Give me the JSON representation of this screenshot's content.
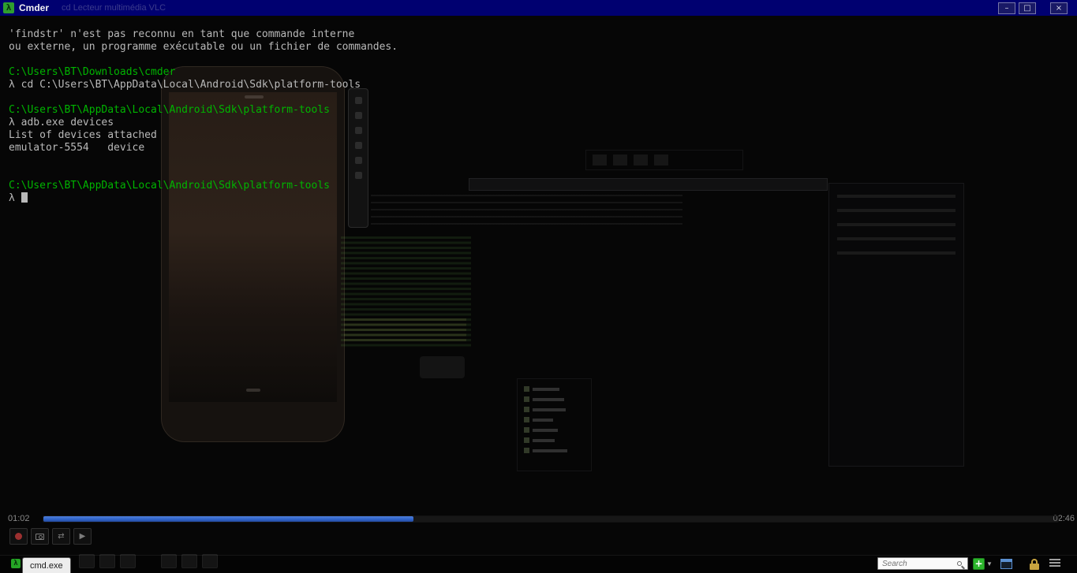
{
  "titlebar": {
    "title": "Cmder",
    "ghost_titles": "cd    Lecteur multimédia VLC"
  },
  "icons": {
    "lambda": "λ",
    "minimize": "–",
    "maximize": "□",
    "close": "×",
    "plus": "+",
    "dropdown": "▼",
    "loop_ab": "⇄",
    "frame_step": "▶"
  },
  "terminal": {
    "prompt_symbol": "λ",
    "lines": [
      {
        "text": "'findstr' n'est pas reconnu en tant que commande interne",
        "color": "gray"
      },
      {
        "text": "ou externe, un programme exécutable ou un fichier de commandes.",
        "color": "gray"
      },
      {
        "text": "",
        "color": "gray"
      },
      {
        "text": "C:\\Users\\BT\\Downloads\\cmder",
        "color": "green"
      },
      {
        "text": "λ cd C:\\Users\\BT\\AppData\\Local\\Android\\Sdk\\platform-tools",
        "color": "gray"
      },
      {
        "text": "",
        "color": "gray"
      },
      {
        "text": "C:\\Users\\BT\\AppData\\Local\\Android\\Sdk\\platform-tools",
        "color": "green"
      },
      {
        "text": "λ adb.exe devices",
        "color": "gray"
      },
      {
        "text": "List of devices attached",
        "color": "gray"
      },
      {
        "text": "emulator-5554   device",
        "color": "gray"
      },
      {
        "text": "",
        "color": "gray"
      },
      {
        "text": "",
        "color": "gray"
      },
      {
        "text": "C:\\Users\\BT\\AppData\\Local\\Android\\Sdk\\platform-tools",
        "color": "green"
      },
      {
        "text": "λ ",
        "color": "gray",
        "cursor": true
      }
    ]
  },
  "player": {
    "time_elapsed": "01:02",
    "time_remaining": "02:46",
    "progress_percent": 36.5
  },
  "statusbar": {
    "tab_label": "cmd.exe",
    "search_placeholder": "Search"
  },
  "colors": {
    "titlebar_blue": "#000070",
    "prompt_green": "#00b400",
    "terminal_gray": "#b9b9b9",
    "progress_blue": "#2e62c8",
    "new_tab_green": "#2cb52c"
  }
}
